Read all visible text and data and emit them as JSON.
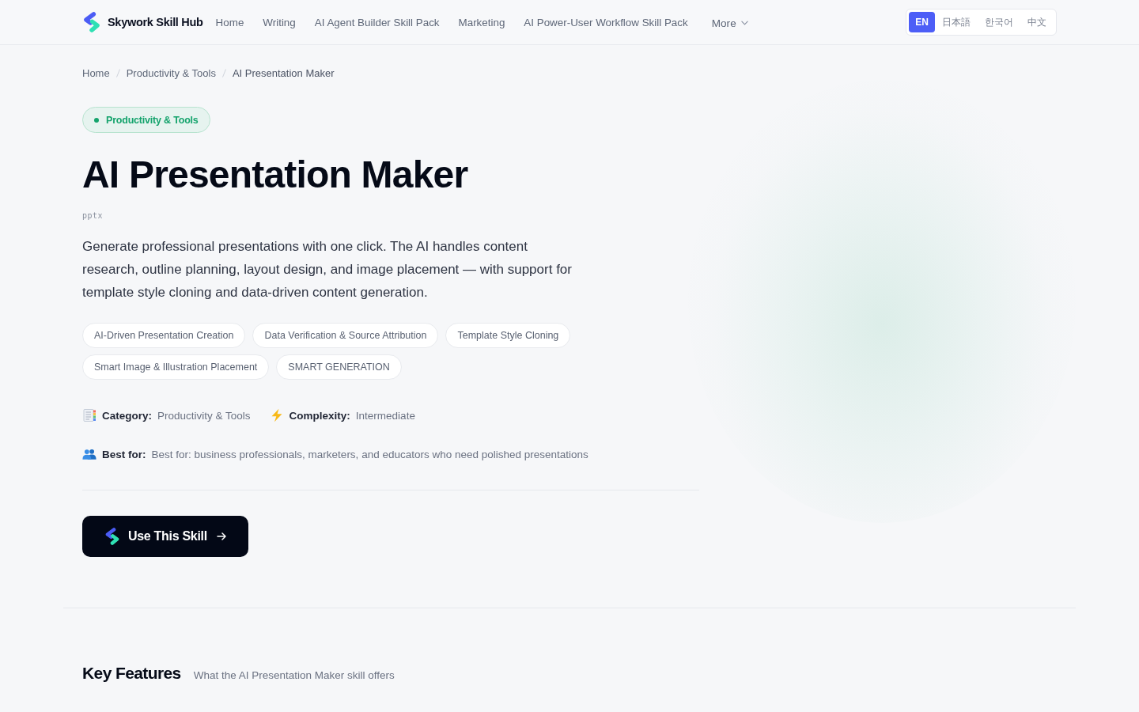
{
  "header": {
    "logo": {
      "text": "Skywork Skill Hub"
    },
    "nav": [
      {
        "label": "Home"
      },
      {
        "label": "Writing"
      },
      {
        "label": "AI Agent Builder Skill Pack"
      },
      {
        "label": "Marketing"
      },
      {
        "label": "AI Power-User Workflow Skill Pack"
      }
    ],
    "more": {
      "label": "More"
    },
    "languages": [
      {
        "label": "EN",
        "selected": true
      },
      {
        "label": "日本語",
        "selected": false
      },
      {
        "label": "한국어",
        "selected": false
      },
      {
        "label": "中文",
        "selected": false
      }
    ]
  },
  "breadcrumb": [
    "Home",
    "Productivity & Tools",
    "AI Presentation Maker"
  ],
  "hero": {
    "category_badge": "Productivity & Tools",
    "title": "AI Presentation Maker",
    "file_type": "pptx",
    "description": "Generate professional presentations with one click. The AI handles content research, outline planning, layout design, and image placement — with support for template style cloning and data-driven content generation.",
    "tags": [
      "AI-Driven Presentation Creation",
      "Data Verification & Source Attribution",
      "Template Style Cloning",
      "Smart Image & Illustration Placement",
      "SMART GENERATION"
    ],
    "meta_rows": [
      [
        {
          "kind": "category",
          "label": "Category:",
          "value": "Productivity & Tools"
        },
        {
          "kind": "complexity",
          "label": "Complexity:",
          "value": "Intermediate"
        }
      ],
      [
        {
          "kind": "audience",
          "label": "Best for:",
          "value": "Best for: business professionals, marketers, and educators who need polished presentations"
        }
      ]
    ],
    "cta": {
      "label": "Use This Skill"
    }
  },
  "key_features": {
    "title": "Key Features",
    "subtitle": "What the AI Presentation Maker skill offers"
  }
}
